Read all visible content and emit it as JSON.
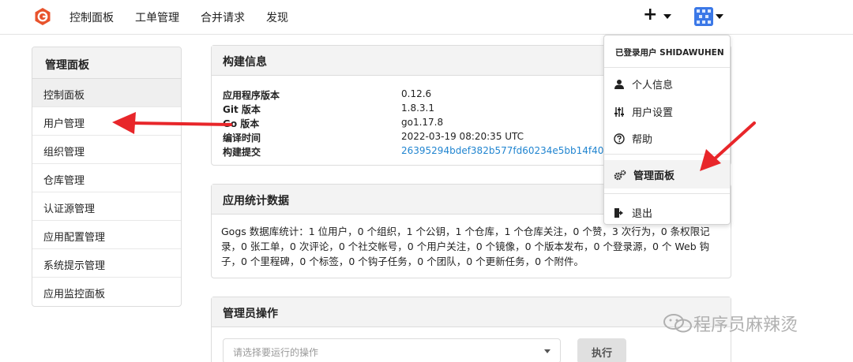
{
  "nav": {
    "items": [
      "控制面板",
      "工单管理",
      "合并请求",
      "发现"
    ]
  },
  "sidebar": {
    "title": "管理面板",
    "items": [
      {
        "label": "控制面板",
        "active": true
      },
      {
        "label": "用户管理",
        "active": false
      },
      {
        "label": "组织管理",
        "active": false
      },
      {
        "label": "仓库管理",
        "active": false
      },
      {
        "label": "认证源管理",
        "active": false
      },
      {
        "label": "应用配置管理",
        "active": false
      },
      {
        "label": "系统提示管理",
        "active": false
      },
      {
        "label": "应用监控面板",
        "active": false
      }
    ]
  },
  "build_info": {
    "title": "构建信息",
    "rows": [
      {
        "key": "应用程序版本",
        "value": "0.12.6"
      },
      {
        "key": "Git 版本",
        "value": "1.8.3.1"
      },
      {
        "key": "Go 版本",
        "value": "go1.17.8"
      },
      {
        "key": "编译时间",
        "value": "2022-03-19 08:20:35 UTC"
      },
      {
        "key": "构建提交",
        "value": "26395294bdef382b577fd60234e5bb14f4090cc8"
      }
    ]
  },
  "stats": {
    "title": "应用统计数据",
    "line1": "Gogs 数据库统计：1 位用户，0 个组织，1 个公钥，1 个仓库，1 个仓库关注，0 个赞，3 次行为，0 条权限记",
    "line2": "录，0 张工单，0 次评论，0 个社交帐号，0 个用户关注，0 个镜像，0 个版本发布，0 个登录源，0 个 Web 钩",
    "line3": "子，0 个里程碑，0 个标签，0 个钩子任务，0 个团队，0 个更新任务，0 个附件。"
  },
  "admin_ops": {
    "title": "管理员操作",
    "select_placeholder": "请选择要运行的操作",
    "exec_label": "执行"
  },
  "dropdown": {
    "header": "已登录用户 SHIDAWUHEN",
    "items": [
      {
        "label": "个人信息",
        "icon": "user-icon"
      },
      {
        "label": "用户设置",
        "icon": "sliders-icon"
      },
      {
        "label": "帮助",
        "icon": "help-icon"
      },
      {
        "label": "管理面板",
        "icon": "cogs-icon",
        "active": true
      },
      {
        "label": "退出",
        "icon": "sign-out-icon"
      }
    ]
  },
  "watermark": "程序员麻辣烫",
  "colors": {
    "accent": "#2185d0",
    "logo": "#e8532c",
    "arrow": "#e8262a"
  }
}
